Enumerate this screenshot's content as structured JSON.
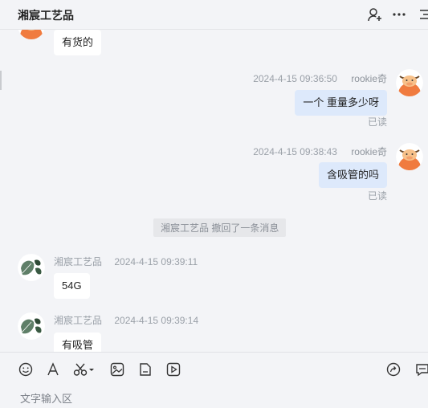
{
  "header": {
    "title": "湘宸工艺品",
    "icons": [
      "add-user-icon",
      "more-icon",
      "menu-icon"
    ]
  },
  "messages": [
    {
      "id": "m1",
      "side": "left",
      "text": "有货的"
    },
    {
      "id": "m2",
      "side": "right",
      "time": "2024-4-15 09:36:50",
      "sender": "rookie奇",
      "text": "一个 重量多少呀",
      "status": "已读"
    },
    {
      "id": "m3",
      "side": "right",
      "time": "2024-4-15 09:38:43",
      "sender": "rookie奇",
      "text": "含吸管的吗",
      "status": "已读"
    },
    {
      "id": "m4",
      "type": "notice",
      "text": "湘宸工艺品 撤回了一条消息"
    },
    {
      "id": "m5",
      "side": "left",
      "sender": "湘宸工艺品",
      "time": "2024-4-15 09:39:11",
      "text": "54G"
    },
    {
      "id": "m6",
      "side": "left",
      "sender": "湘宸工艺品",
      "time": "2024-4-15 09:39:14",
      "text": "有吸管"
    }
  ],
  "toolbar": {
    "tools": [
      "emoji-icon",
      "font-icon",
      "scissors-icon",
      "image-icon",
      "file-icon",
      "video-icon",
      "share-icon",
      "quick-reply-icon"
    ]
  },
  "input": {
    "placeholder": "文字输入区"
  },
  "colors": {
    "background": "#f3f4f7",
    "outgoing_bubble": "#dde9fb",
    "incoming_bubble": "#ffffff",
    "meta_text": "#9aa0a8"
  }
}
